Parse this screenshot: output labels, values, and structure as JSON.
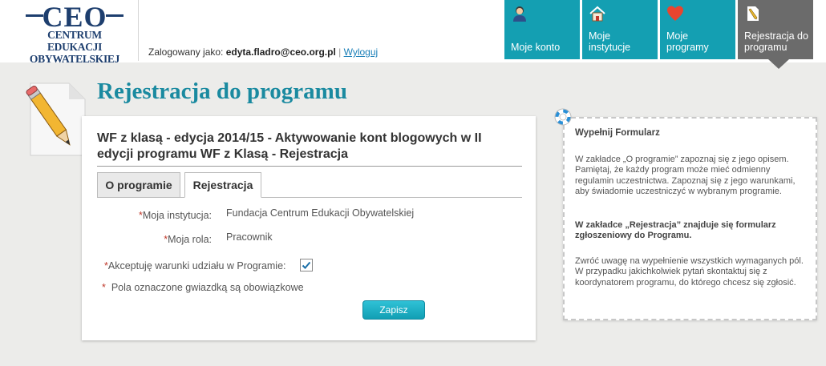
{
  "logo": {
    "big": "CEO",
    "line1": "CENTRUM EDUKACJI",
    "line2": "OBYWATELSKIEJ"
  },
  "login": {
    "prefix": "Zalogowany jako:",
    "email": "edyta.fladro@ceo.org.pl",
    "separator": "|",
    "logout": "Wyloguj"
  },
  "nav": {
    "items": [
      {
        "label": "Moje konto",
        "icon": "user-icon"
      },
      {
        "label": "Moje instytucje",
        "icon": "house-icon"
      },
      {
        "label": "Moje programy",
        "icon": "heart-icon"
      },
      {
        "label": "Rejestracja do programu",
        "icon": "document-pen-icon",
        "active": true
      }
    ]
  },
  "page": {
    "title": "Rejestracja do programu"
  },
  "panel": {
    "title": "WF z klasą - edycja 2014/15 - Aktywowanie kont blogowych w II edycji programu WF z Klasą - Rejestracja",
    "tabs": [
      {
        "label": "O programie"
      },
      {
        "label": "Rejestracja",
        "active": true
      }
    ],
    "form": {
      "required_mark": "*",
      "institution_label": "Moja instytucja:",
      "institution_value": "Fundacja Centrum Edukacji Obywatelskiej",
      "role_label": "Moja rola:",
      "role_value": "Pracownik",
      "accept_label": "Akceptuję warunki udziału w Programie:",
      "accept_checked": true,
      "required_note": "Pola oznaczone gwiazdką są obowiązkowe",
      "save_label": "Zapisz"
    }
  },
  "help": {
    "title": "Wypełnij Formularz",
    "p1": "W zakładce „O programie” zapoznaj się z jego opisem. Pamiętaj, że każdy program może mieć odmienny regulamin uczestnictwa. Zapoznaj się z jego warunkami, aby świadomie uczestniczyć w wybranym programie.",
    "p2": "W zakładce „Rejestracja” znajduje się formularz zgłoszeniowy do Programu.",
    "p3": "Zwróć uwagę na wypełnienie wszystkich wymaganych pól. W przypadku jakichkolwiek pytań skontaktuj się z koordynatorem programu, do którego chcesz się zgłosić."
  },
  "colors": {
    "accent": "#149fb2",
    "active_nav": "#6b6b6b",
    "title": "#1a8aa0",
    "required": "#c0392b",
    "link": "#1a7fb8"
  }
}
